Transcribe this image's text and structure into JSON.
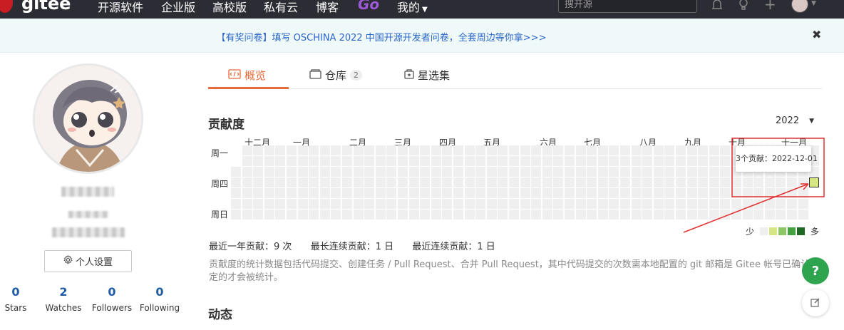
{
  "nav": {
    "brand": "gitee",
    "items": [
      "开源软件",
      "企业版",
      "高校版",
      "私有云",
      "博客"
    ],
    "go": "Go",
    "mine": "我的",
    "search_placeholder": "搜开源"
  },
  "banner": {
    "text": "【有奖问卷】填写 OSCHINA 2022 中国开源开发者问卷，全套周边等你拿>>>",
    "close": "✖"
  },
  "sidebar": {
    "settings_label": "个人设置",
    "stats": [
      {
        "value": "0",
        "label": "Stars"
      },
      {
        "value": "2",
        "label": "Watches"
      },
      {
        "value": "0",
        "label": "Followers"
      },
      {
        "value": "0",
        "label": "Following"
      }
    ]
  },
  "tabs": [
    {
      "label": "概览",
      "count": ""
    },
    {
      "label": "仓库",
      "count": "2"
    },
    {
      "label": "星选集",
      "count": ""
    }
  ],
  "contribution": {
    "title": "贡献度",
    "year": "2022",
    "months": [
      "十二月",
      "一月",
      "二月",
      "三月",
      "四月",
      "五月",
      "六月",
      "七月",
      "八月",
      "九月",
      "十月",
      "十一月"
    ],
    "days": [
      "周一",
      "周四",
      "周日"
    ],
    "tooltip": "3个贡献：2022-12-01",
    "legend_less": "少",
    "legend_more": "多",
    "legend_colors": [
      "#efefef",
      "#d6e685",
      "#8cc665",
      "#44a340",
      "#1e6823"
    ],
    "highlight_color": "#d6e685",
    "annotation_color": "#e03030",
    "summary": {
      "year_label": "最近一年贡献：9 次",
      "longest_label": "最长连续贡献：1 日",
      "recent_label": "最近连续贡献：1 日"
    },
    "description": "贡献度的统计数据包括代码提交、创建任务 / Pull Request、合并 Pull Request，其中代码提交的次数需本地配置的 git 邮箱是 Gitee 帐号已确认绑定的才会被统计。"
  },
  "activity": {
    "title": "动态"
  },
  "help": {
    "label": "?"
  }
}
